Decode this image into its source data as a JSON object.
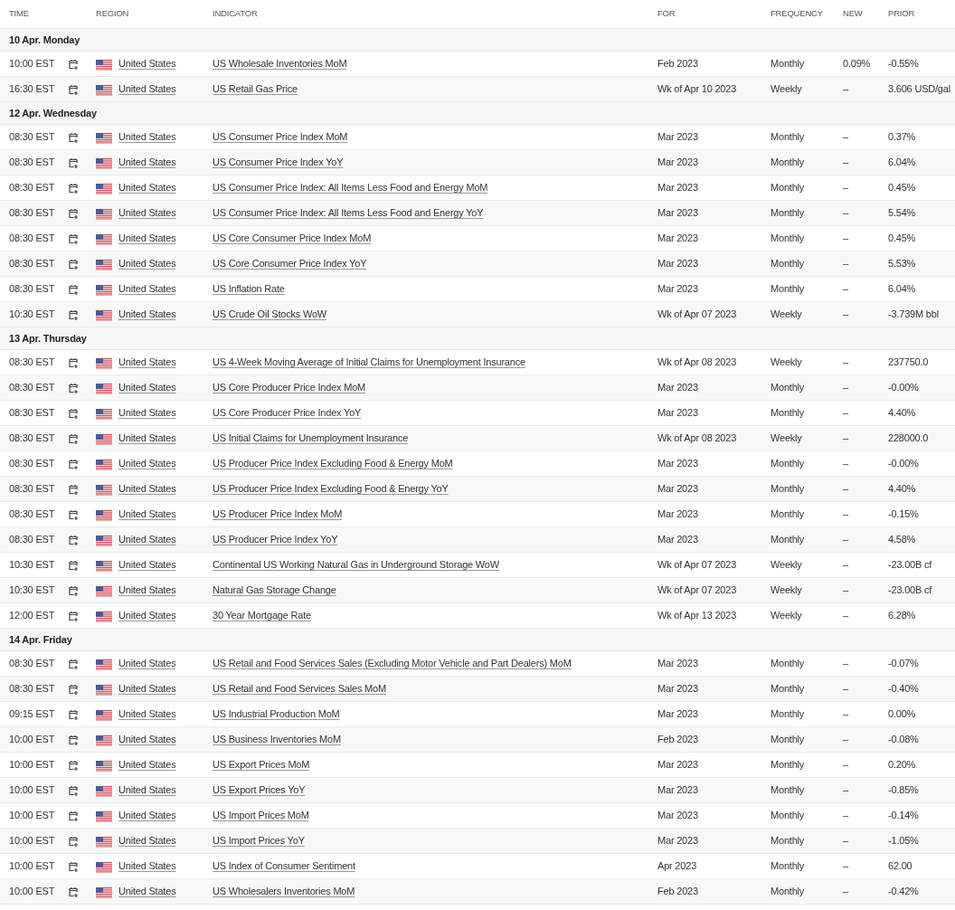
{
  "columns": [
    "TIME",
    "REGION",
    "INDICATOR",
    "FOR",
    "FREQUENCY",
    "NEW",
    "PRIOR"
  ],
  "days": [
    {
      "label": "10 Apr. Monday",
      "events": [
        {
          "time": "10:00 EST",
          "region": "United States",
          "indicator": "US Wholesale Inventories MoM",
          "for": "Feb 2023",
          "frequency": "Monthly",
          "new": "0.09%",
          "prior": "-0.55%"
        },
        {
          "time": "16:30 EST",
          "region": "United States",
          "indicator": "US Retail Gas Price",
          "for": "Wk of Apr 10 2023",
          "frequency": "Weekly",
          "new": "–",
          "prior": "3.606 USD/gal"
        }
      ]
    },
    {
      "label": "12 Apr. Wednesday",
      "events": [
        {
          "time": "08:30 EST",
          "region": "United States",
          "indicator": "US Consumer Price Index MoM",
          "for": "Mar 2023",
          "frequency": "Monthly",
          "new": "–",
          "prior": "0.37%"
        },
        {
          "time": "08:30 EST",
          "region": "United States",
          "indicator": "US Consumer Price Index YoY",
          "for": "Mar 2023",
          "frequency": "Monthly",
          "new": "–",
          "prior": "6.04%"
        },
        {
          "time": "08:30 EST",
          "region": "United States",
          "indicator": "US Consumer Price Index: All Items Less Food and Energy MoM",
          "for": "Mar 2023",
          "frequency": "Monthly",
          "new": "–",
          "prior": "0.45%"
        },
        {
          "time": "08:30 EST",
          "region": "United States",
          "indicator": "US Consumer Price Index: All Items Less Food and Energy YoY",
          "for": "Mar 2023",
          "frequency": "Monthly",
          "new": "–",
          "prior": "5.54%"
        },
        {
          "time": "08:30 EST",
          "region": "United States",
          "indicator": "US Core Consumer Price Index MoM",
          "for": "Mar 2023",
          "frequency": "Monthly",
          "new": "–",
          "prior": "0.45%"
        },
        {
          "time": "08:30 EST",
          "region": "United States",
          "indicator": "US Core Consumer Price Index YoY",
          "for": "Mar 2023",
          "frequency": "Monthly",
          "new": "–",
          "prior": "5.53%"
        },
        {
          "time": "08:30 EST",
          "region": "United States",
          "indicator": "US Inflation Rate",
          "for": "Mar 2023",
          "frequency": "Monthly",
          "new": "–",
          "prior": "6.04%"
        },
        {
          "time": "10:30 EST",
          "region": "United States",
          "indicator": "US Crude Oil Stocks WoW",
          "for": "Wk of Apr 07 2023",
          "frequency": "Weekly",
          "new": "–",
          "prior": "-3.739M bbl"
        }
      ]
    },
    {
      "label": "13 Apr. Thursday",
      "events": [
        {
          "time": "08:30 EST",
          "region": "United States",
          "indicator": "US 4-Week Moving Average of Initial Claims for Unemployment Insurance",
          "for": "Wk of Apr 08 2023",
          "frequency": "Weekly",
          "new": "–",
          "prior": "237750.0"
        },
        {
          "time": "08:30 EST",
          "region": "United States",
          "indicator": "US Core Producer Price Index MoM",
          "for": "Mar 2023",
          "frequency": "Monthly",
          "new": "–",
          "prior": "-0.00%"
        },
        {
          "time": "08:30 EST",
          "region": "United States",
          "indicator": "US Core Producer Price Index YoY",
          "for": "Mar 2023",
          "frequency": "Monthly",
          "new": "–",
          "prior": "4.40%"
        },
        {
          "time": "08:30 EST",
          "region": "United States",
          "indicator": "US Initial Claims for Unemployment Insurance",
          "for": "Wk of Apr 08 2023",
          "frequency": "Weekly",
          "new": "–",
          "prior": "228000.0"
        },
        {
          "time": "08:30 EST",
          "region": "United States",
          "indicator": "US Producer Price Index Excluding Food & Energy MoM",
          "for": "Mar 2023",
          "frequency": "Monthly",
          "new": "–",
          "prior": "-0.00%"
        },
        {
          "time": "08:30 EST",
          "region": "United States",
          "indicator": "US Producer Price Index Excluding Food & Energy YoY",
          "for": "Mar 2023",
          "frequency": "Monthly",
          "new": "–",
          "prior": "4.40%"
        },
        {
          "time": "08:30 EST",
          "region": "United States",
          "indicator": "US Producer Price Index MoM",
          "for": "Mar 2023",
          "frequency": "Monthly",
          "new": "–",
          "prior": "-0.15%"
        },
        {
          "time": "08:30 EST",
          "region": "United States",
          "indicator": "US Producer Price Index YoY",
          "for": "Mar 2023",
          "frequency": "Monthly",
          "new": "–",
          "prior": "4.58%"
        },
        {
          "time": "10:30 EST",
          "region": "United States",
          "indicator": "Continental US Working Natural Gas in Underground Storage WoW",
          "for": "Wk of Apr 07 2023",
          "frequency": "Weekly",
          "new": "–",
          "prior": "-23.00B cf"
        },
        {
          "time": "10:30 EST",
          "region": "United States",
          "indicator": "Natural Gas Storage Change",
          "for": "Wk of Apr 07 2023",
          "frequency": "Weekly",
          "new": "–",
          "prior": "-23.00B cf"
        },
        {
          "time": "12:00 EST",
          "region": "United States",
          "indicator": "30 Year Mortgage Rate",
          "for": "Wk of Apr 13 2023",
          "frequency": "Weekly",
          "new": "–",
          "prior": "6.28%"
        }
      ]
    },
    {
      "label": "14 Apr. Friday",
      "events": [
        {
          "time": "08:30 EST",
          "region": "United States",
          "indicator": "US Retail and Food Services Sales (Excluding Motor Vehicle and Part Dealers) MoM",
          "for": "Mar 2023",
          "frequency": "Monthly",
          "new": "–",
          "prior": "-0.07%"
        },
        {
          "time": "08:30 EST",
          "region": "United States",
          "indicator": "US Retail and Food Services Sales MoM",
          "for": "Mar 2023",
          "frequency": "Monthly",
          "new": "–",
          "prior": "-0.40%"
        },
        {
          "time": "09:15 EST",
          "region": "United States",
          "indicator": "US Industrial Production MoM",
          "for": "Mar 2023",
          "frequency": "Monthly",
          "new": "–",
          "prior": "0.00%"
        },
        {
          "time": "10:00 EST",
          "region": "United States",
          "indicator": "US Business Inventories MoM",
          "for": "Feb 2023",
          "frequency": "Monthly",
          "new": "–",
          "prior": "-0.08%"
        },
        {
          "time": "10:00 EST",
          "region": "United States",
          "indicator": "US Export Prices MoM",
          "for": "Mar 2023",
          "frequency": "Monthly",
          "new": "–",
          "prior": "0.20%"
        },
        {
          "time": "10:00 EST",
          "region": "United States",
          "indicator": "US Export Prices YoY",
          "for": "Mar 2023",
          "frequency": "Monthly",
          "new": "–",
          "prior": "-0.85%"
        },
        {
          "time": "10:00 EST",
          "region": "United States",
          "indicator": "US Import Prices MoM",
          "for": "Mar 2023",
          "frequency": "Monthly",
          "new": "–",
          "prior": "-0.14%"
        },
        {
          "time": "10:00 EST",
          "region": "United States",
          "indicator": "US Import Prices YoY",
          "for": "Mar 2023",
          "frequency": "Monthly",
          "new": "–",
          "prior": "-1.05%"
        },
        {
          "time": "10:00 EST",
          "region": "United States",
          "indicator": "US Index of Consumer Sentiment",
          "for": "Apr 2023",
          "frequency": "Monthly",
          "new": "–",
          "prior": "62.00"
        },
        {
          "time": "10:00 EST",
          "region": "United States",
          "indicator": "US Wholesalers Inventories MoM",
          "for": "Feb 2023",
          "frequency": "Monthly",
          "new": "–",
          "prior": "-0.42%"
        }
      ]
    }
  ]
}
